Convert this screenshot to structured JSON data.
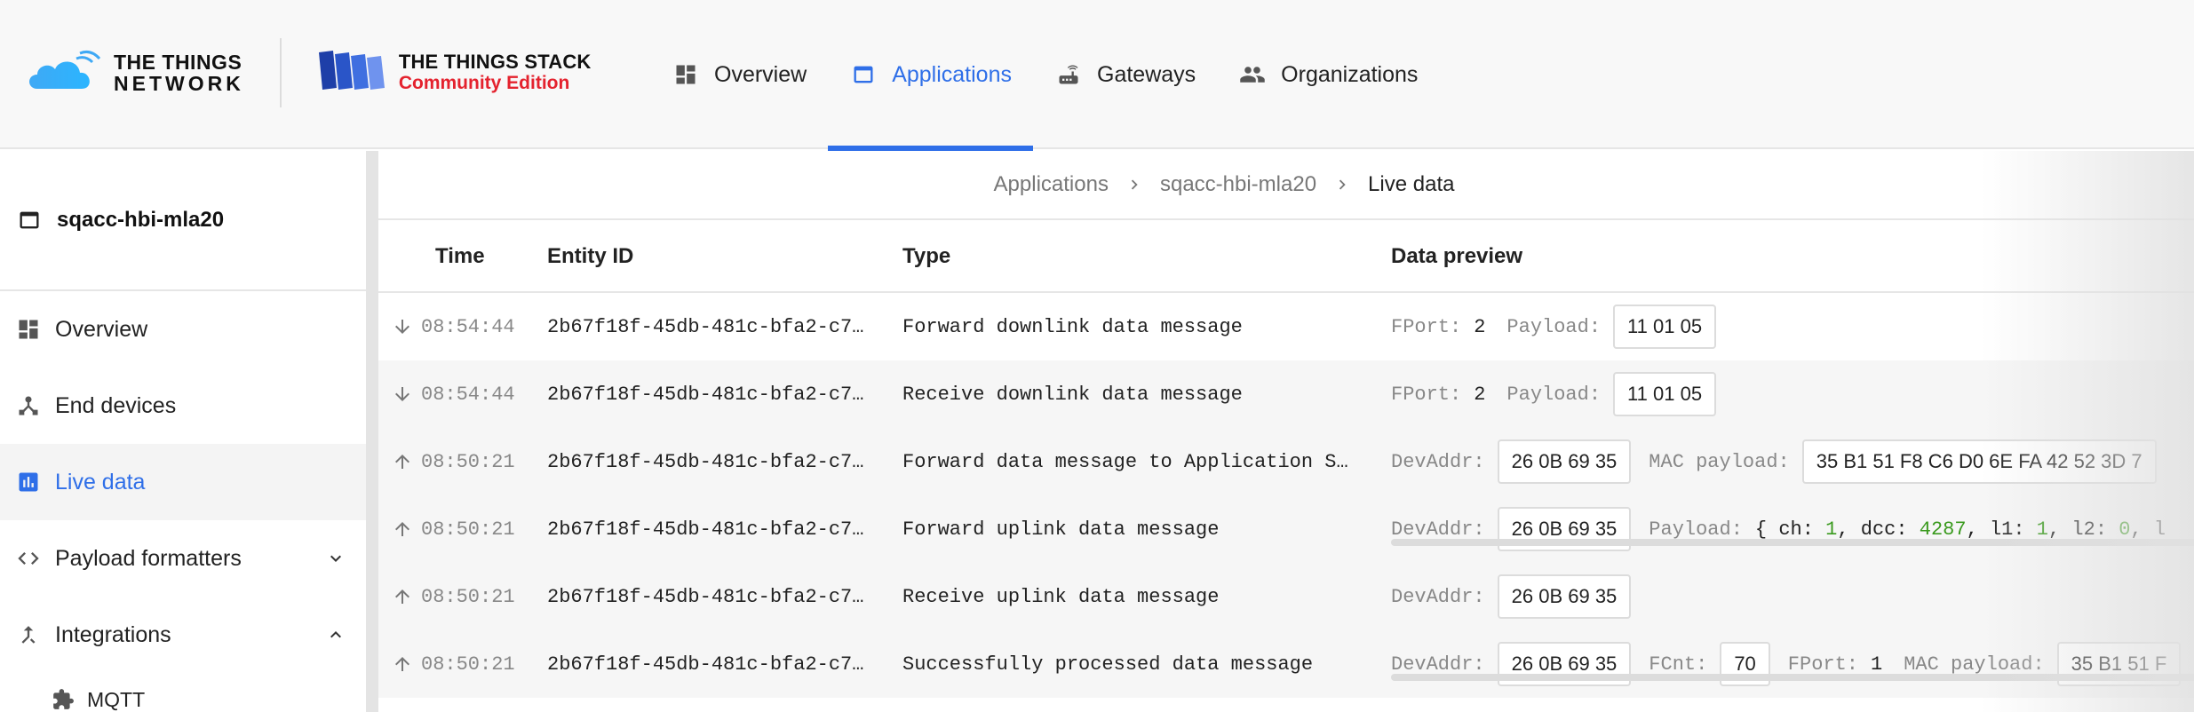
{
  "brand": {
    "ttn_line1": "THE THINGS",
    "ttn_line2": "NETWORK",
    "tts_line1": "THE THINGS STACK",
    "tts_line2": "Community Edition"
  },
  "topnav": [
    {
      "label": "Overview",
      "icon": "dashboard-icon",
      "active": false
    },
    {
      "label": "Applications",
      "icon": "window-icon",
      "active": true
    },
    {
      "label": "Gateways",
      "icon": "router-icon",
      "active": false
    },
    {
      "label": "Organizations",
      "icon": "people-icon",
      "active": false
    }
  ],
  "sidebar": {
    "app_name": "sqacc-hbi-mla20",
    "items": [
      {
        "label": "Overview",
        "icon": "dashboard-icon"
      },
      {
        "label": "End devices",
        "icon": "device-hub-icon"
      },
      {
        "label": "Live data",
        "icon": "bar-chart-icon",
        "active": true
      },
      {
        "label": "Payload formatters",
        "icon": "code-icon",
        "chevron": "down"
      },
      {
        "label": "Integrations",
        "icon": "merge-icon",
        "chevron": "up"
      }
    ],
    "subitems": [
      {
        "label": "MQTT",
        "icon": "puzzle-icon"
      }
    ]
  },
  "breadcrumb": [
    "Applications",
    "sqacc-hbi-mla20",
    "Live data"
  ],
  "table": {
    "headers": {
      "time": "Time",
      "entity": "Entity ID",
      "type": "Type",
      "preview": "Data preview"
    },
    "rows": [
      {
        "dir": "down",
        "time": "08:54:44",
        "entity": "2b67f18f-45db-481c-bfa2-c7…",
        "type": "Forward downlink data message",
        "preview": {
          "k1": "FPort:",
          "v1": "2",
          "k2": "Payload:",
          "box2": "11 01 05"
        }
      },
      {
        "dir": "down",
        "time": "08:54:44",
        "entity": "2b67f18f-45db-481c-bfa2-c7…",
        "type": "Receive downlink data message",
        "preview": {
          "k1": "FPort:",
          "v1": "2",
          "k2": "Payload:",
          "box2": "11 01 05"
        }
      },
      {
        "dir": "up",
        "time": "08:50:21",
        "entity": "2b67f18f-45db-481c-bfa2-c7…",
        "type": "Forward data message to Application S…",
        "preview": {
          "k1": "DevAddr:",
          "box1": "26 0B 69 35",
          "k2": "MAC payload:",
          "box2": "35 B1 51 F8 C6 D0 6E FA 42 52 3D 7"
        }
      },
      {
        "dir": "up",
        "time": "08:50:21",
        "entity": "2b67f18f-45db-481c-bfa2-c7…",
        "type": "Forward uplink data message",
        "preview": {
          "k1": "DevAddr:",
          "box1": "26 0B 69 35",
          "k2": "Payload:",
          "obj": [
            {
              "k": "ch",
              "v": "1"
            },
            {
              "k": "dcc",
              "v": "4287"
            },
            {
              "k": "l1",
              "v": "1"
            },
            {
              "k": "l2",
              "v": "0"
            }
          ]
        }
      },
      {
        "dir": "up",
        "time": "08:50:21",
        "entity": "2b67f18f-45db-481c-bfa2-c7…",
        "type": "Receive uplink data message",
        "preview": {
          "k1": "DevAddr:",
          "box1": "26 0B 69 35"
        }
      },
      {
        "dir": "up",
        "time": "08:50:21",
        "entity": "2b67f18f-45db-481c-bfa2-c7…",
        "type": "Successfully processed data message",
        "preview": {
          "k1": "DevAddr:",
          "box1": "26 0B 69 35",
          "k2": "FCnt:",
          "box2": "70",
          "k3": "FPort:",
          "v3": "1",
          "k4": "MAC payload:",
          "box4": "35 B1 51 F"
        }
      }
    ]
  },
  "colors": {
    "accent": "#2f6fe8",
    "brand_red": "#e4222e",
    "number_green": "#3a9a1e"
  }
}
